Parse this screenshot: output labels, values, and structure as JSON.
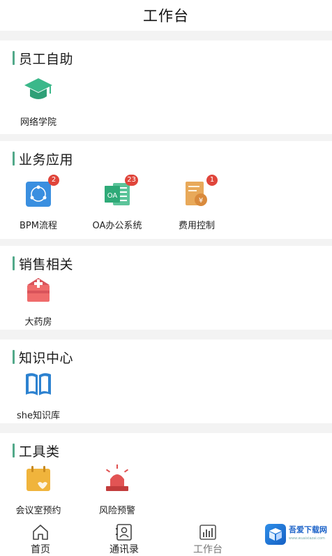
{
  "header": {
    "title": "工作台"
  },
  "sections": [
    {
      "title": "员工自助",
      "items": [
        {
          "label": "网络学院",
          "icon": "graduation-cap-icon"
        }
      ]
    },
    {
      "title": "业务应用",
      "items": [
        {
          "label": "BPM流程",
          "icon": "bpm-flow-icon",
          "badge": "2"
        },
        {
          "label": "OA办公系统",
          "icon": "oa-system-icon",
          "badge": "23"
        },
        {
          "label": "费用控制",
          "icon": "expense-control-icon",
          "badge": "1"
        }
      ]
    },
    {
      "title": "销售相关",
      "items": [
        {
          "label": "大药房",
          "icon": "pharmacy-icon"
        }
      ]
    },
    {
      "title": "知识中心",
      "items": [
        {
          "label": "she知识库",
          "icon": "book-icon"
        }
      ]
    },
    {
      "title": "工具类",
      "items": [
        {
          "label": "会议室预约",
          "icon": "calendar-icon"
        },
        {
          "label": "风险预警",
          "icon": "alarm-light-icon"
        }
      ]
    }
  ],
  "tabbar": {
    "tabs": [
      {
        "label": "首页",
        "icon": "home-icon"
      },
      {
        "label": "通讯录",
        "icon": "contacts-icon"
      },
      {
        "label": "工作台",
        "icon": "workbench-icon",
        "active": true
      }
    ]
  },
  "watermark": {
    "text": "吾爱下载网",
    "sub": "www.wuaixiazai.com"
  },
  "colors": {
    "accent": "#52a98a",
    "badge": "#e0453b",
    "page_bg": "#f3f3f3"
  }
}
